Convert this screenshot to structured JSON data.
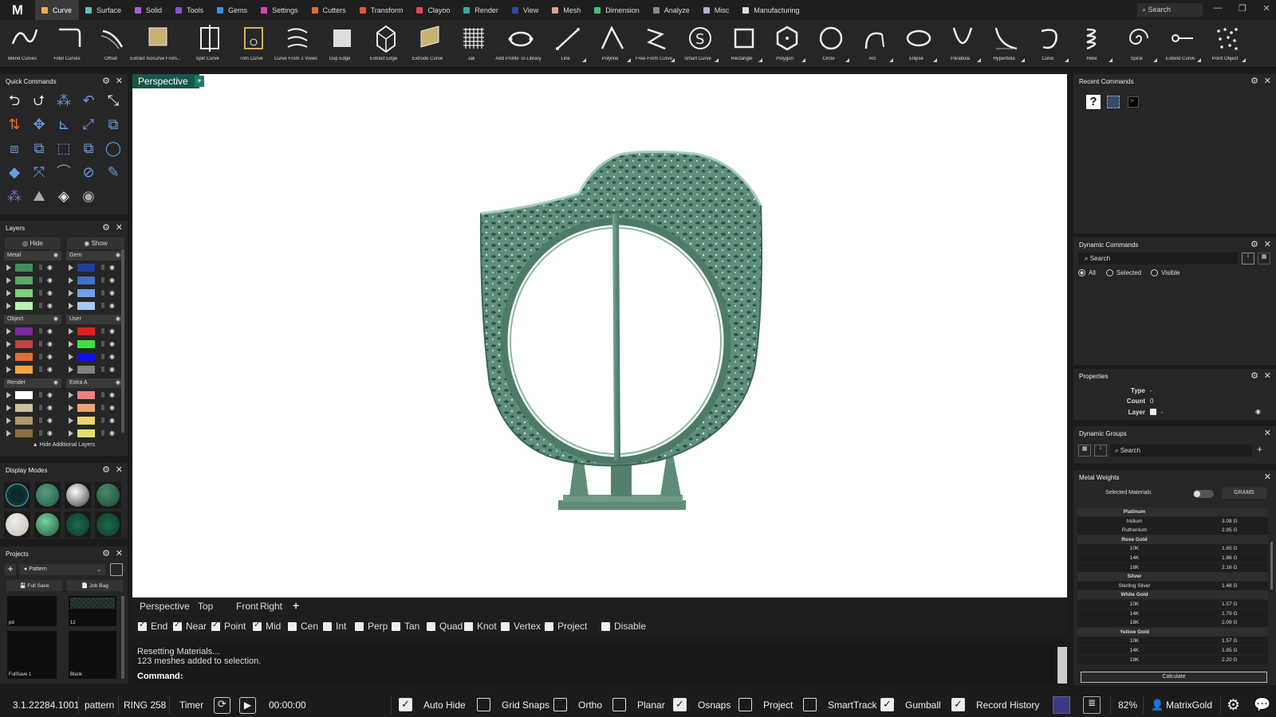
{
  "menu": {
    "logo": "M",
    "tabs": [
      {
        "label": "Curve",
        "color": "#e8b04a",
        "active": true
      },
      {
        "label": "Surface",
        "color": "#5bc0be"
      },
      {
        "label": "Solid",
        "color": "#b05bd6"
      },
      {
        "label": "Tools",
        "color": "#8a4fc8"
      },
      {
        "label": "Gems",
        "color": "#3d8fe0"
      },
      {
        "label": "Settings",
        "color": "#d04ab0"
      },
      {
        "label": "Cutters",
        "color": "#e06a3a"
      },
      {
        "label": "Transform",
        "color": "#e05a3a"
      },
      {
        "label": "Clayoo",
        "color": "#e04a4a"
      },
      {
        "label": "Render",
        "color": "#3aa8a0"
      },
      {
        "label": "View",
        "color": "#2a4ea0"
      },
      {
        "label": "Mesh",
        "color": "#e0a08a"
      },
      {
        "label": "Dimension",
        "color": "#4ac070"
      },
      {
        "label": "Analyze",
        "color": "#888888"
      },
      {
        "label": "Misc",
        "color": "#b0b0d8"
      },
      {
        "label": "Manufacturing",
        "color": "#dddddd"
      }
    ],
    "search_placeholder": "Search"
  },
  "toolbar": [
    "Blend Curves",
    "Fillet Curves",
    "Offset",
    "Extract Isocurve From...",
    "Split Curve",
    "Trim Curve",
    "Curve From 2 Views",
    "Dup Edge",
    "Extract Edge",
    "Extrude Curve",
    "Jali",
    "Add Profile To Library",
    "Line",
    "Polyline",
    "Free-Form Curve",
    "Smart Curve",
    "Rectangle",
    "Polygon",
    "Circle",
    "Arc",
    "Ellipse",
    "Parabola",
    "Hyperbola",
    "Conic",
    "Helix",
    "Spiral",
    "Extend Curve",
    "Point Object"
  ],
  "quick_commands": {
    "title": "Quick Commands"
  },
  "layers": {
    "title": "Layers",
    "hide_label": "Hide",
    "show_label": "Show",
    "groups": [
      {
        "name": "Metal",
        "colors": [
          "#3f8f5a",
          "#5aa86a",
          "#7fd07f",
          "#b8f0b0"
        ]
      },
      {
        "name": "Gem",
        "colors": [
          "#1f3f9f",
          "#3f6fd0",
          "#6f9fe8",
          "#a8c8f0"
        ]
      },
      {
        "name": "Object",
        "colors": [
          "#7a2aa0",
          "#c04040",
          "#e07030",
          "#f0a840"
        ]
      },
      {
        "name": "User",
        "colors": [
          "#e02020",
          "#40e040",
          "#1010e0",
          "#808080"
        ]
      },
      {
        "name": "Render",
        "colors": [
          "#ffffff",
          "#d0c0a0",
          "#b09a70",
          "#8a7040"
        ]
      },
      {
        "name": "Extra A",
        "colors": [
          "#f08080",
          "#f0a070",
          "#f0d070",
          "#e0e070"
        ]
      }
    ],
    "hide_additional": "Hide Additional Layers"
  },
  "display_modes": {
    "title": "Display Modes"
  },
  "projects": {
    "title": "Projects",
    "selected": "Pattern",
    "full_save": "Full Save",
    "job_bag": "Job Bag",
    "thumbs": [
      "pd",
      "12",
      "FullSave 1",
      "Blank"
    ]
  },
  "viewport": {
    "active_view": "Perspective",
    "tabs": [
      "Perspective",
      "Top",
      "Front",
      "Right",
      "+"
    ]
  },
  "snaps": [
    {
      "label": "End",
      "on": true
    },
    {
      "label": "Near",
      "on": true
    },
    {
      "label": "Point",
      "on": true
    },
    {
      "label": "Mid",
      "on": true
    },
    {
      "label": "Cen",
      "on": false
    },
    {
      "label": "Int",
      "on": false
    },
    {
      "label": "Perp",
      "on": false
    },
    {
      "label": "Tan",
      "on": false
    },
    {
      "label": "Quad",
      "on": false
    },
    {
      "label": "Knot",
      "on": false
    },
    {
      "label": "Vertex",
      "on": false
    },
    {
      "label": "Project",
      "on": false
    },
    {
      "label": "Disable",
      "on": false
    }
  ],
  "command": {
    "history": [
      "Resetting Materials...",
      "123 meshes added to selection."
    ],
    "prompt": "Command:"
  },
  "status": {
    "version": "3.1.22284.1001",
    "project": "pattern",
    "file": "RING 258",
    "timer_label": "Timer",
    "timer_value": "00:00:00",
    "toggles": [
      {
        "label": "Auto Hide",
        "on": true
      },
      {
        "label": "Grid Snaps",
        "on": false
      },
      {
        "label": "Ortho",
        "on": false
      },
      {
        "label": "Planar",
        "on": false
      },
      {
        "label": "Osnaps",
        "on": true
      },
      {
        "label": "Project",
        "on": false
      },
      {
        "label": "SmartTrack",
        "on": false
      },
      {
        "label": "Gumball",
        "on": true
      },
      {
        "label": "Record History",
        "on": true
      }
    ],
    "zoom": "82%",
    "user": "MatrixGold"
  },
  "recent_commands": {
    "title": "Recent Commands"
  },
  "dynamic_commands": {
    "title": "Dynamic Commands",
    "search_placeholder": "Search",
    "filters": [
      {
        "label": "All",
        "selected": true
      },
      {
        "label": "Selected",
        "selected": false
      },
      {
        "label": "Visible",
        "selected": false
      }
    ]
  },
  "properties": {
    "title": "Properties",
    "type_label": "Type",
    "type_value": "-",
    "count_label": "Count",
    "count_value": "0",
    "layer_label": "Layer",
    "layer_value": "-"
  },
  "dynamic_groups": {
    "title": "Dynamic Groups",
    "search_placeholder": "Search"
  },
  "metal_weights": {
    "title": "Metal Weights",
    "selected_materials": "Selected Materials",
    "unit": "GRAMS",
    "rows": [
      {
        "name": "Platinum",
        "value": "",
        "header": true
      },
      {
        "name": "Iridium",
        "value": "3.08 G"
      },
      {
        "name": "Ruthenium",
        "value": "2.95 G"
      },
      {
        "name": "Rose Gold",
        "value": "",
        "header": true
      },
      {
        "name": "10K",
        "value": "1.65 G"
      },
      {
        "name": "14K",
        "value": "1.86 G"
      },
      {
        "name": "18K",
        "value": "2.16 G"
      },
      {
        "name": "Silver",
        "value": "",
        "header": true
      },
      {
        "name": "Sterling Silver",
        "value": "1.48 G"
      },
      {
        "name": "White Gold",
        "value": "",
        "header": true
      },
      {
        "name": "10K",
        "value": "1.57 G"
      },
      {
        "name": "14K",
        "value": "1.79 G"
      },
      {
        "name": "18K",
        "value": "2.09 G"
      },
      {
        "name": "Yellow Gold",
        "value": "",
        "header": true
      },
      {
        "name": "10K",
        "value": "1.57 G"
      },
      {
        "name": "14K",
        "value": "1.85 G"
      },
      {
        "name": "18K",
        "value": "2.20 G"
      }
    ],
    "calculate": "Calculate"
  }
}
